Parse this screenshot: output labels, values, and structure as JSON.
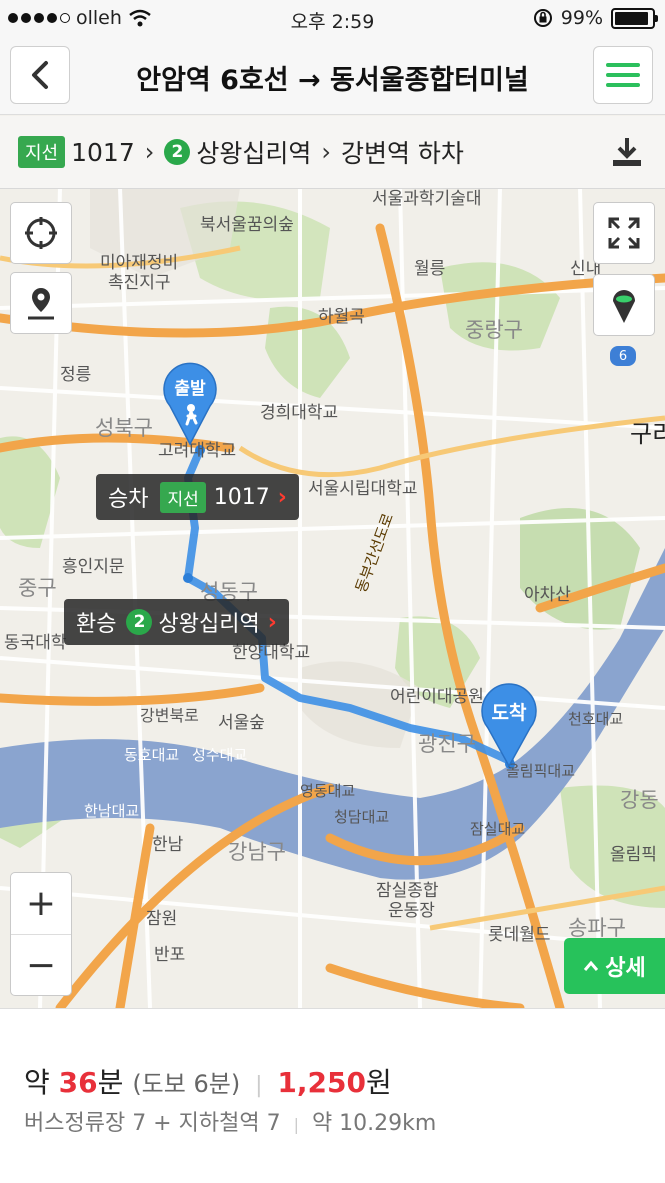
{
  "status": {
    "carrier": "olleh",
    "time": "오후 2:59",
    "battery": "99%"
  },
  "header": {
    "title": "안암역 6호선 → 동서울종합터미널",
    "back_icon": "back-arrow-icon",
    "menu_icon": "hamburger-menu-icon"
  },
  "route": {
    "bus_tag": "지선",
    "bus_no": "1017",
    "subway_line": "2",
    "transfer_station": "상왕십리역",
    "dropoff": "강변역 하차"
  },
  "map": {
    "labels": [
      "북서울꿈의숲",
      "미아재정비",
      "촉진지구",
      "정릉",
      "성북구",
      "고려대학교",
      "경희대학교",
      "서울시립대학교",
      "하월곡",
      "월릉",
      "신내",
      "중랑구",
      "구리",
      "흥인지문",
      "중구",
      "동국대학",
      "성동구",
      "한양대학교",
      "아차산",
      "어린이대공원",
      "광진구",
      "천호대교",
      "올림픽대교",
      "강변북로",
      "서울숲",
      "동호대교",
      "성수대교",
      "영동대교",
      "청담대교",
      "잠실대교",
      "한남대교",
      "한남",
      "강남구",
      "잠원",
      "반포",
      "잠실종합",
      "운동장",
      "롯데월드",
      "송파구",
      "강동",
      "올림픽",
      "서울과학기술대",
      "동부간선도로",
      "6"
    ],
    "start_pin": "출발",
    "end_pin": "도착",
    "board_bubble": {
      "prefix": "승차",
      "tag": "지선",
      "number": "1017"
    },
    "transfer_bubble": {
      "prefix": "환승",
      "line": "2",
      "station": "상왕십리역"
    },
    "zoom_in": "+",
    "zoom_out": "−",
    "detail_button": "상세"
  },
  "summary": {
    "approx": "약",
    "minutes": "36",
    "min_unit": "분",
    "walk": "(도보 6분)",
    "fare": "1,250",
    "fare_unit": "원",
    "stops": "버스정류장 7 + 지하철역 7",
    "distance": "약 10.29km"
  },
  "colors": {
    "green": "#2bbf5c",
    "route": "#3d8fe6",
    "red": "#e8303a",
    "river": "#8aa4cf"
  }
}
